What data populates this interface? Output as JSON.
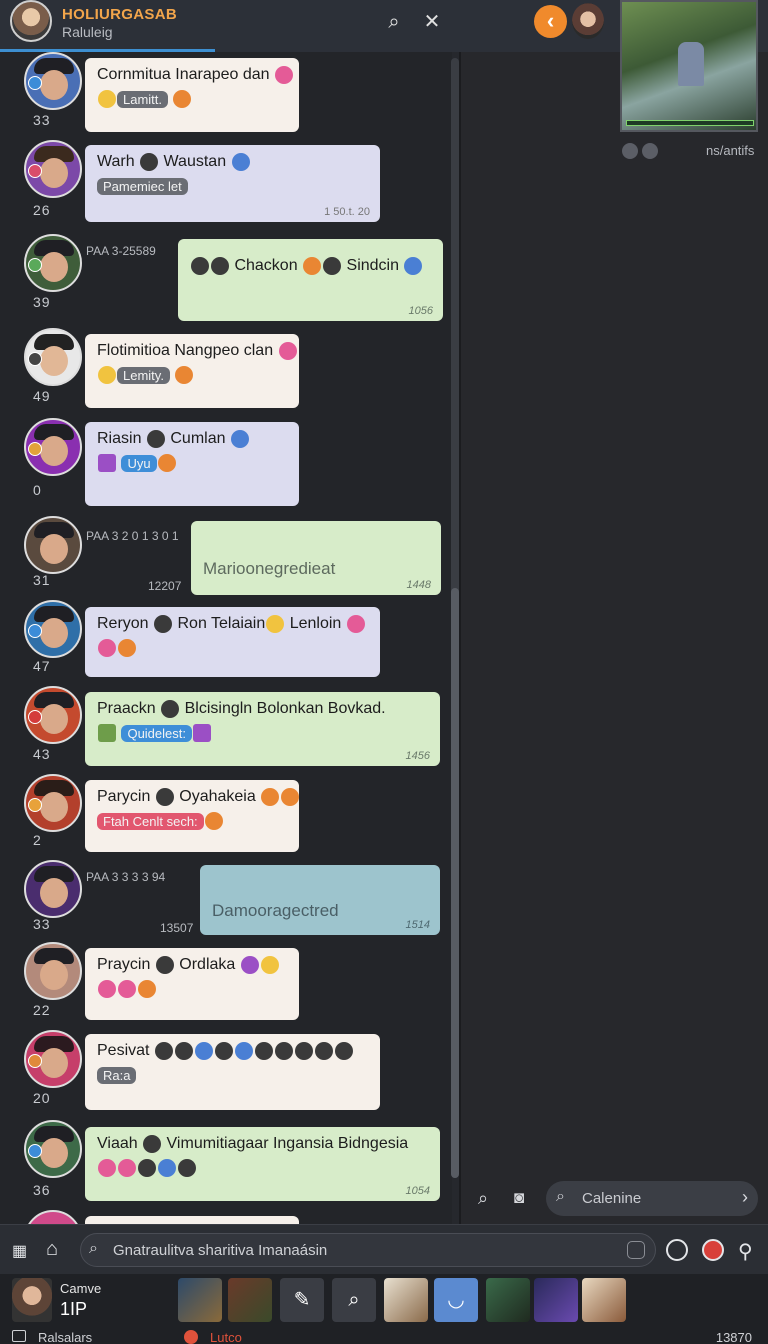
{
  "header": {
    "title": "HOLIURGASAB",
    "subtitle": "Raluleig",
    "progress": 0.28,
    "search_icon": "search-icon",
    "close_icon": "close-icon",
    "back_icon": "chevron-left-icon",
    "accent": "#f08a2c"
  },
  "messages": [
    {
      "num": "33",
      "line1": "Cornmitua Inarapeo dan",
      "tag": "Lamitt.",
      "ts": ""
    },
    {
      "num": "26",
      "line1": "Warh",
      "line1b": "Waustan",
      "tag": "Pamemiec let",
      "ts": "1 50.t. 20"
    },
    {
      "num": "39",
      "side_ts": "PAA 3-25589",
      "line1": "Chackon",
      "line1b": "Sindcin",
      "ts": "1056"
    },
    {
      "num": "49",
      "line1": "Flotimitioa Nangpeo clan",
      "tag": "Lemity.",
      "ts": ""
    },
    {
      "num": "0",
      "line1": "Riasin",
      "line1b": "Cumlan",
      "tag": "Uyu",
      "ts": ""
    },
    {
      "num": "31",
      "side_ts": "PAA 3 2 0 1 3 0 1",
      "side_ts2": "12207",
      "line1": "Marioonegredieat",
      "ts": "1448"
    },
    {
      "num": "47",
      "line1": "Reryon",
      "line1b": "Ron Telaiain",
      "line1c": "Lenloin",
      "ts": ""
    },
    {
      "num": "43",
      "line1": "Praackn",
      "line1b": "Blcisingln Bolonkan Bovkad.",
      "tag": "Quidelest:",
      "ts": "1456"
    },
    {
      "num": "2",
      "line1": "Parycin",
      "line1b": "Oyahakeia",
      "tag": "Ftah Cenlt sech:",
      "ts": ""
    },
    {
      "num": "33",
      "side_ts": "PAA 3 3 3 3 94",
      "side_ts2": "13507",
      "line1": "Damooragectred",
      "ts": "1514"
    },
    {
      "num": "22",
      "line1": "Praycin",
      "line1b": "Ordlaka",
      "ts": ""
    },
    {
      "num": "20",
      "line1": "Pesivat",
      "tag": "Ra:a",
      "ts": ""
    },
    {
      "num": "36",
      "line1": "Viaah",
      "line1b": "Vimumitiagaar Ingansia Bidngesia",
      "ts": "1054"
    }
  ],
  "right_panel": {
    "video_caption": "ns/antifs",
    "search_placeholder": "Calenine"
  },
  "bottom_bar": {
    "search_placeholder": "Gnatraulitva sharitiva Imanaásin"
  },
  "taskbar": {
    "user_name": "Camve",
    "user_count": "1IP",
    "label": "Ralsalars",
    "alert_label": "Lutco",
    "clock": "13870"
  }
}
